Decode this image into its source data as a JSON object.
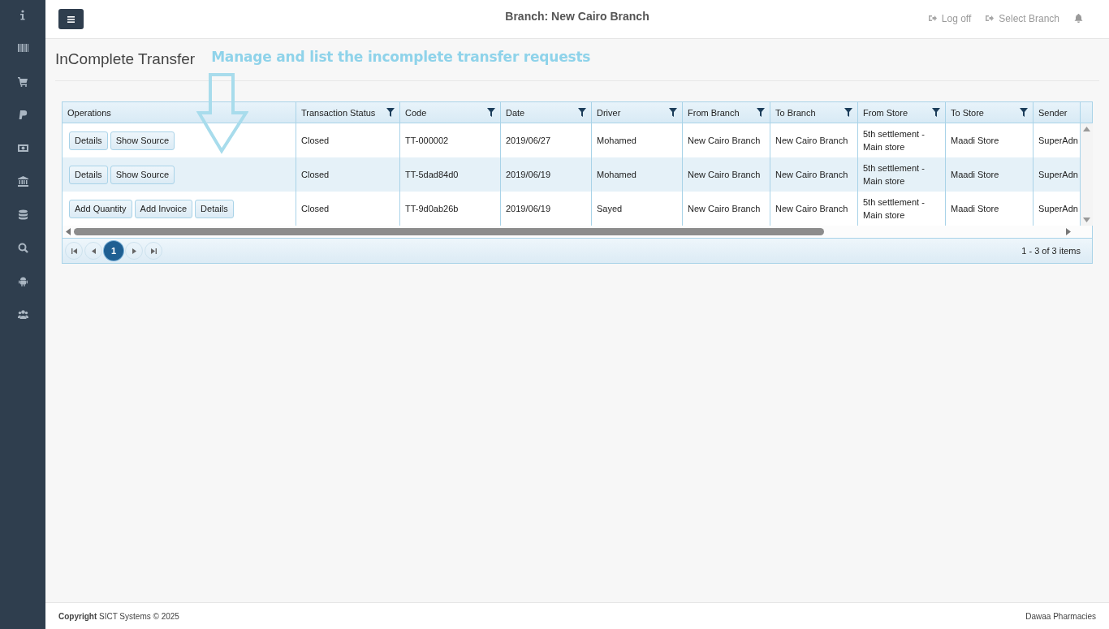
{
  "topbar": {
    "branch_label": "Branch:",
    "branch_name": "New Cairo Branch",
    "links": [
      {
        "label": "Log off"
      },
      {
        "label": "Select Branch"
      }
    ]
  },
  "page_title": "InComplete Transfer",
  "annotation": "Manage and list the incomplete transfer requests",
  "grid": {
    "columns": [
      {
        "label": "Operations",
        "filterable": false
      },
      {
        "label": "Transaction Status",
        "filterable": true
      },
      {
        "label": "Code",
        "filterable": true
      },
      {
        "label": "Date",
        "filterable": true
      },
      {
        "label": "Driver",
        "filterable": true
      },
      {
        "label": "From Branch",
        "filterable": true
      },
      {
        "label": "To Branch",
        "filterable": true
      },
      {
        "label": "From Store",
        "filterable": true
      },
      {
        "label": "To Store",
        "filterable": true
      },
      {
        "label": "Sender",
        "filterable": false
      }
    ],
    "rows": [
      {
        "operations": [
          "Details",
          "Show Source"
        ],
        "transaction_status": "Closed",
        "code": "TT-000002",
        "date": "2019/06/27",
        "driver": "Mohamed",
        "from_branch": "New Cairo Branch",
        "to_branch": "New Cairo Branch",
        "from_store": "5th settlement - Main store",
        "to_store": "Maadi Store",
        "sender": "SuperAdn"
      },
      {
        "operations": [
          "Details",
          "Show Source"
        ],
        "transaction_status": "Closed",
        "code": "TT-5dad84d0",
        "date": "2019/06/19",
        "driver": "Mohamed",
        "from_branch": "New Cairo Branch",
        "to_branch": "New Cairo Branch",
        "from_store": "5th settlement - Main store",
        "to_store": "Maadi Store",
        "sender": "SuperAdn"
      },
      {
        "operations": [
          "Add Quantity",
          "Add Invoice",
          "Details"
        ],
        "transaction_status": "Closed",
        "code": "TT-9d0ab26b",
        "date": "2019/06/19",
        "driver": "Sayed",
        "from_branch": "New Cairo Branch",
        "to_branch": "New Cairo Branch",
        "from_store": "5th settlement - Main store",
        "to_store": "Maadi Store",
        "sender": "SuperAdn"
      }
    ],
    "pager": {
      "pages": [
        {
          "label": "1",
          "selected": true
        }
      ],
      "info": "1 - 3 of 3 items"
    }
  },
  "footer": {
    "copyright": "**Copyright** SICT Systems © 2025",
    "brand": "Dawaa Pharmacies"
  }
}
